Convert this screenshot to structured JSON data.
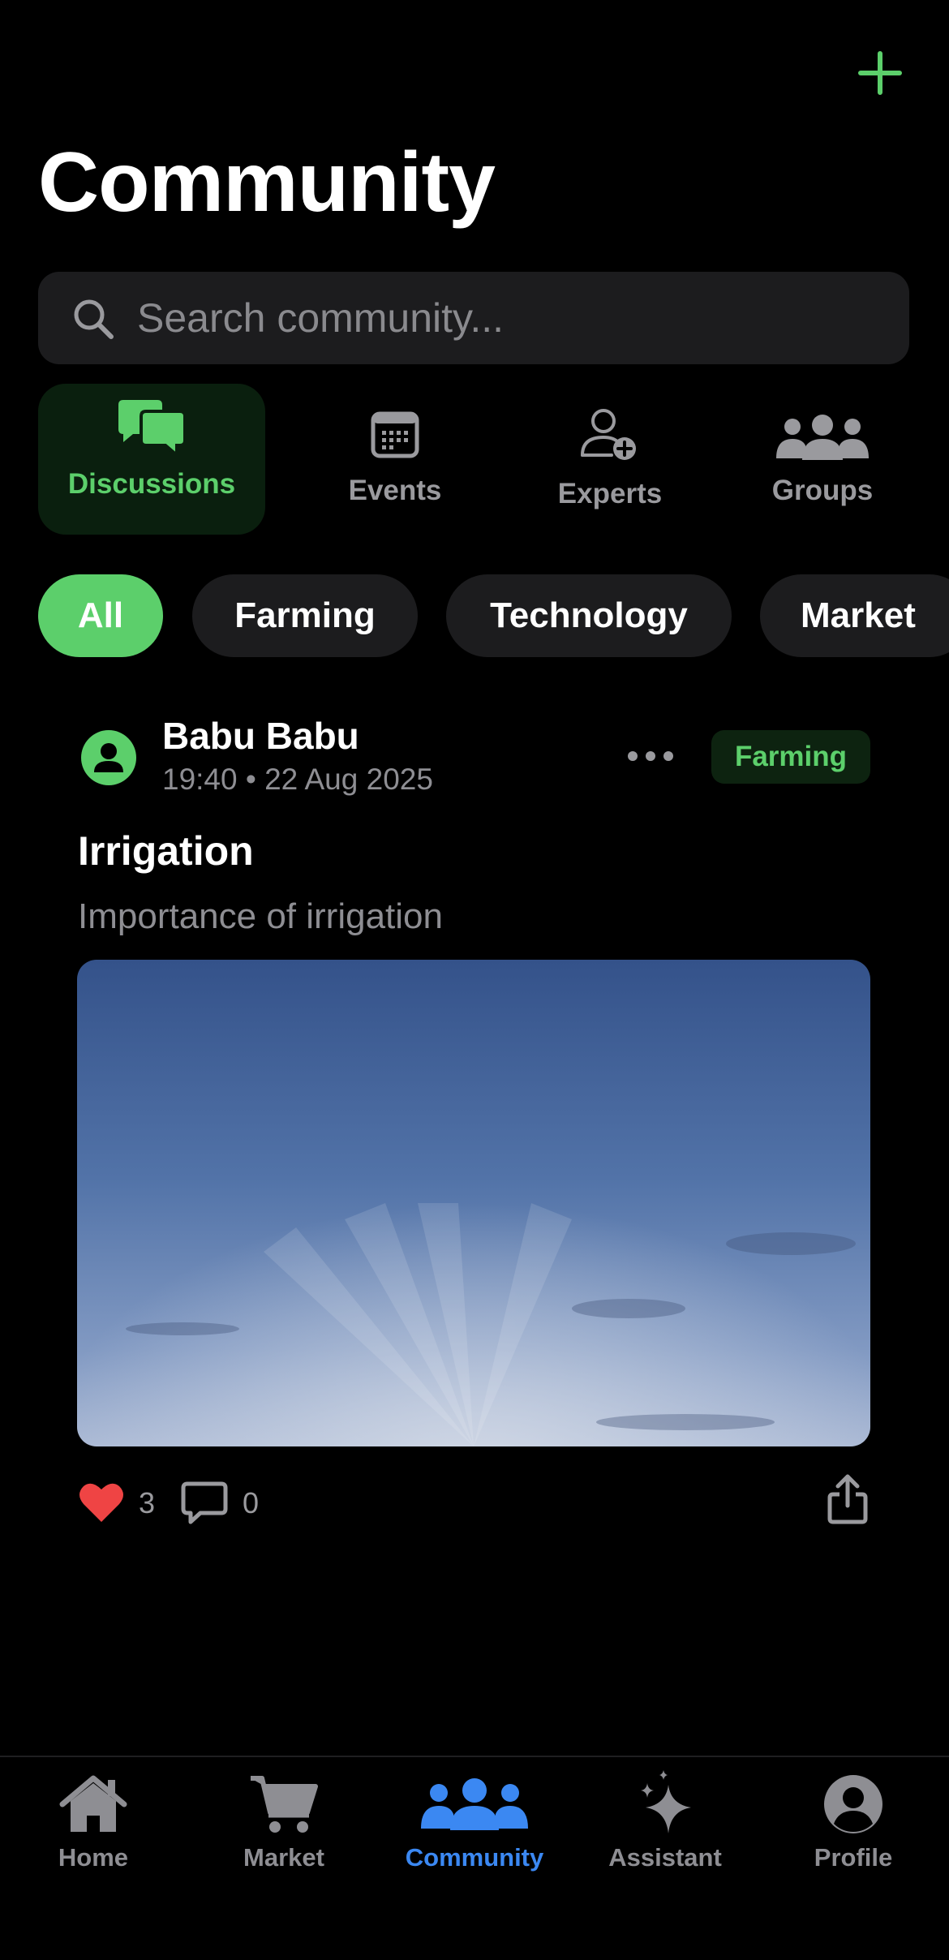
{
  "header": {
    "title": "Community",
    "add_icon": "plus-icon",
    "accent": "#5ccf6b"
  },
  "search": {
    "placeholder": "Search community...",
    "value": ""
  },
  "section_tabs": [
    {
      "label": "Discussions",
      "icon": "chat-bubbles-icon",
      "active": true
    },
    {
      "label": "Events",
      "icon": "calendar-icon",
      "active": false
    },
    {
      "label": "Experts",
      "icon": "person-add-icon",
      "active": false
    },
    {
      "label": "Groups",
      "icon": "people-icon",
      "active": false
    }
  ],
  "filters": [
    {
      "label": "All",
      "active": true
    },
    {
      "label": "Farming",
      "active": false
    },
    {
      "label": "Technology",
      "active": false
    },
    {
      "label": "Market",
      "active": false
    }
  ],
  "post": {
    "author": "Babu Babu",
    "time": "19:40",
    "date": "22 Aug 2025",
    "meta": "19:40 • 22 Aug 2025",
    "tag": "Farming",
    "title": "Irrigation",
    "body": "Importance of irrigation",
    "likes": "3",
    "comments": "0",
    "liked": true
  },
  "tabbar": [
    {
      "label": "Home",
      "icon": "house-icon",
      "active": false
    },
    {
      "label": "Market",
      "icon": "cart-icon",
      "active": false
    },
    {
      "label": "Community",
      "icon": "people-icon",
      "active": true
    },
    {
      "label": "Assistant",
      "icon": "sparkles-icon",
      "active": false
    },
    {
      "label": "Profile",
      "icon": "person-circle-icon",
      "active": false
    }
  ],
  "colors": {
    "background": "#000000",
    "accent_green": "#5ccf6b",
    "active_blue": "#3b88f2",
    "like_red": "#ef4444"
  }
}
